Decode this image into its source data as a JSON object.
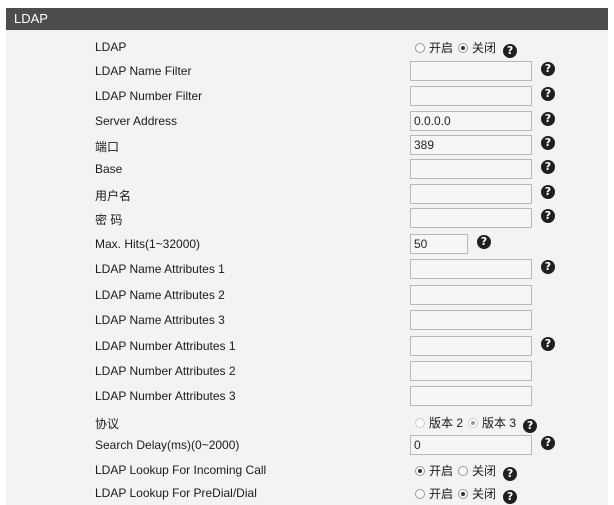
{
  "header": {
    "title": "LDAP"
  },
  "icons": {
    "help": "?"
  },
  "rows": [
    {
      "label": "LDAP",
      "type": "radio",
      "options": [
        "开启",
        "关闭"
      ],
      "selected": 1
    },
    {
      "label": "LDAP Name Filter",
      "type": "input",
      "value": ""
    },
    {
      "label": "LDAP Number Filter",
      "type": "input",
      "value": ""
    },
    {
      "label": "Server Address",
      "type": "input",
      "value": "0.0.0.0"
    },
    {
      "label": "端口",
      "type": "input",
      "value": "389"
    },
    {
      "label": "Base",
      "type": "input",
      "value": ""
    },
    {
      "label": "用户名",
      "type": "input",
      "value": ""
    },
    {
      "label": "密 码",
      "type": "input",
      "value": ""
    },
    {
      "label": "Max. Hits(1~32000)",
      "type": "input-short",
      "value": "50"
    },
    {
      "label": "LDAP Name Attributes 1",
      "type": "input",
      "value": ""
    },
    {
      "label": "LDAP Name Attributes 2",
      "type": "input",
      "value": ""
    },
    {
      "label": "LDAP Name Attributes 3",
      "type": "input",
      "value": ""
    },
    {
      "label": "LDAP Number Attributes 1",
      "type": "input",
      "value": ""
    },
    {
      "label": "LDAP Number Attributes 2",
      "type": "input",
      "value": ""
    },
    {
      "label": "LDAP Number Attributes 3",
      "type": "input",
      "value": ""
    },
    {
      "label": "协议",
      "type": "radio",
      "options": [
        "版本 2",
        "版本 3"
      ],
      "selected": 1
    },
    {
      "label": "Search Delay(ms)(0~2000)",
      "type": "input",
      "value": "0"
    },
    {
      "label": "LDAP Lookup For Incoming Call",
      "type": "radio",
      "options": [
        "开启",
        "关闭"
      ],
      "selected": 0
    },
    {
      "label": "LDAP Lookup For PreDial/Dial",
      "type": "radio",
      "options": [
        "开启",
        "关闭"
      ],
      "selected": 1
    }
  ]
}
